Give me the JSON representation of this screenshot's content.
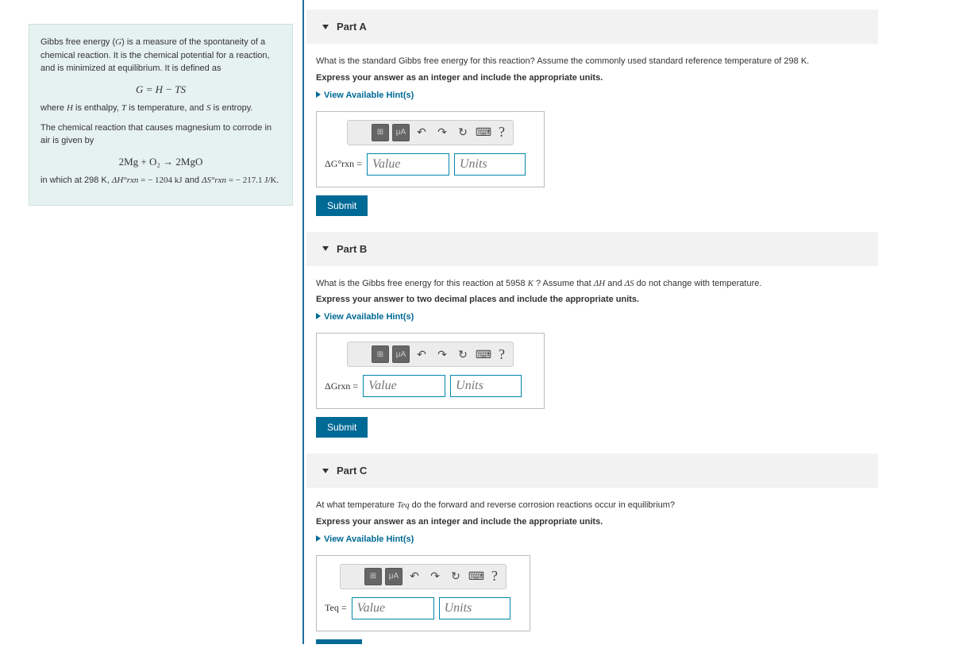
{
  "sidebar": {
    "intro_pre": "Gibbs free energy (",
    "intro_G": "G",
    "intro_post": ") is a measure of the spontaneity of a chemical reaction. It is the chemical potential for a reaction, and is minimized at equilibrium. It is defined as",
    "formula1": "G = H − TS",
    "where_pre": "where ",
    "where_H": "H",
    "where_mid1": " is enthalpy, ",
    "where_T": "T",
    "where_mid2": " is temperature, and ",
    "where_S": "S",
    "where_post": " is entropy.",
    "corrode": "The chemical reaction that causes magnesium to corrode in air is given by",
    "formula2": "2Mg + O₂ → 2MgO",
    "vals_pre": "in which at 298 K, ",
    "dH_label": "ΔH°rxn",
    "dH_val": " = − 1204 kJ",
    "vals_and": " and ",
    "dS_label": "ΔS°rxn",
    "dS_val": " = − 217.1 J/K."
  },
  "parts": {
    "A": {
      "title": "Part A",
      "question": "What is the standard Gibbs free energy for this reaction? Assume the commonly used standard reference temperature of 298 K.",
      "instr": "Express your answer as an integer and include the appropriate units.",
      "label": "ΔG°rxn ="
    },
    "B": {
      "title": "Part B",
      "question_pre": "What is the Gibbs free energy for this reaction at 5958 ",
      "K": "K",
      "question_mid": " ? Assume that ",
      "dH": "ΔH",
      "question_and": " and ",
      "dS": "ΔS",
      "question_post": " do not change with temperature.",
      "instr": "Express your answer to two decimal places and include the appropriate units.",
      "label": "ΔGrxn ="
    },
    "C": {
      "title": "Part C",
      "question_pre": "At what temperature ",
      "Teq": "Teq",
      "question_post": " do the forward and reverse corrosion reactions occur in equilibrium?",
      "instr": "Express your answer as an integer and include the appropriate units.",
      "label": "Teq ="
    }
  },
  "common": {
    "hints": "View Available Hint(s)",
    "value_ph": "Value",
    "units_ph": "Units",
    "submit": "Submit",
    "q": "?"
  },
  "toolbar_icons": {
    "template": "⊞",
    "mu": "μA",
    "undo": "↶",
    "redo": "↷",
    "reset": "↻",
    "keyboard": "⌨"
  }
}
